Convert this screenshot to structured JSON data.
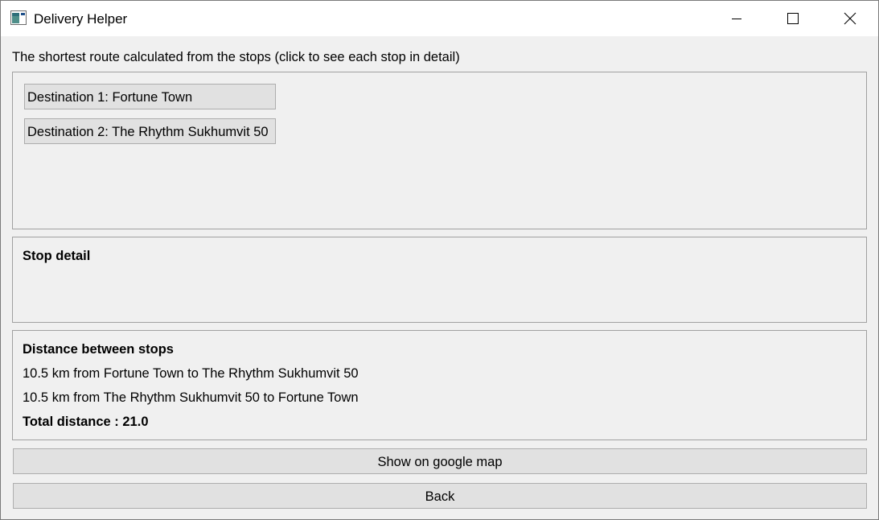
{
  "window": {
    "title": "Delivery Helper",
    "icon": "app-icon",
    "controls": [
      "minimize-icon",
      "maximize-icon",
      "close-icon"
    ]
  },
  "route": {
    "label": "The shortest route calculated from the stops (click to see each stop in detail)",
    "destinations": [
      {
        "label": "Destination 1: Fortune Town"
      },
      {
        "label": "Destination 2: The Rhythm Sukhumvit 50"
      }
    ]
  },
  "stop_detail": {
    "heading": "Stop detail"
  },
  "distance": {
    "heading": "Distance between stops",
    "lines": [
      "10.5 km from Fortune Town to The Rhythm Sukhumvit 50",
      "10.5 km from The Rhythm Sukhumvit 50 to Fortune Town"
    ],
    "total": "Total distance : 21.0"
  },
  "buttons": {
    "map": "Show on google map",
    "back": "Back"
  },
  "colors": {
    "window_bg": "#f0f0f0",
    "titlebar_bg": "#ffffff",
    "button_bg": "#e1e1e1",
    "button_border": "#adadad",
    "group_border": "#a0a0a0"
  }
}
